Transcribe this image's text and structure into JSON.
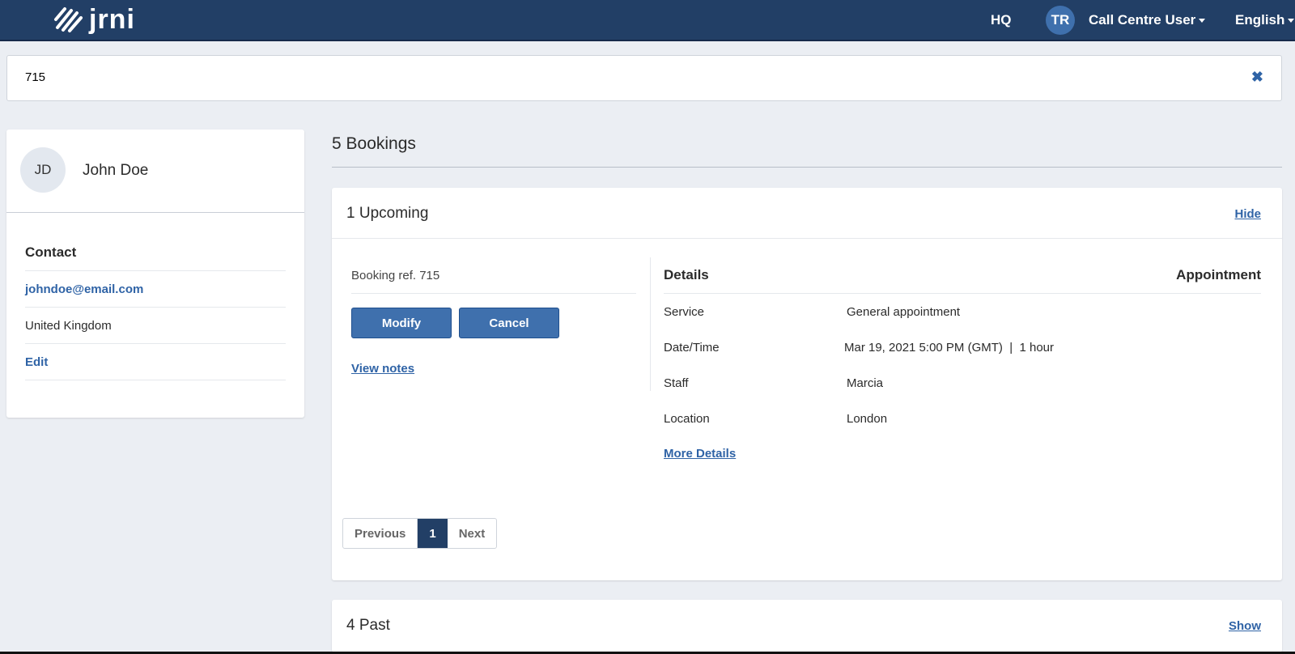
{
  "header": {
    "logo": "jrni",
    "hq": "HQ",
    "avatar_initials": "TR",
    "user": "Call Centre User",
    "language": "English"
  },
  "search": {
    "value": "715"
  },
  "customer": {
    "initials": "JD",
    "name": "John Doe",
    "contact_heading": "Contact",
    "email": "johndoe@email.com",
    "country": "United Kingdom",
    "edit": "Edit"
  },
  "bookings": {
    "title": "5 Bookings",
    "upcoming": {
      "heading": "1 Upcoming",
      "toggle": "Hide",
      "ref": "Booking ref. 715",
      "modify": "Modify",
      "cancel": "Cancel",
      "view_notes": "View notes",
      "details_heading": "Details",
      "type": "Appointment",
      "details": [
        {
          "label": "Service",
          "value": "General appointment"
        },
        {
          "label": "Date/Time",
          "value": "Mar 19, 2021 5:00 PM (GMT)  |  1 hour"
        },
        {
          "label": "Staff",
          "value": "Marcia"
        },
        {
          "label": "Location",
          "value": "London"
        }
      ],
      "more_details": "More Details",
      "pagination": {
        "previous": "Previous",
        "current": "1",
        "next": "Next"
      }
    },
    "past": {
      "heading": "4 Past",
      "toggle": "Show"
    }
  },
  "colors": {
    "header": "#223f66",
    "accent": "#3f70ad",
    "link": "#2f63a6"
  }
}
